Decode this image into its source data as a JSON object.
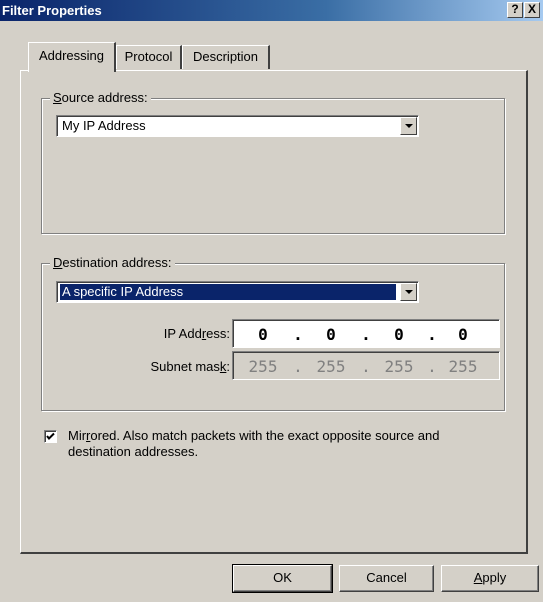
{
  "window": {
    "title": "Filter Properties",
    "help_button": "?",
    "close_button": "X"
  },
  "tabs": [
    {
      "label": "Addressing",
      "active": true
    },
    {
      "label": "Protocol",
      "active": false
    },
    {
      "label": "Description",
      "active": false
    }
  ],
  "source": {
    "legend_mnemonic": "S",
    "legend_rest": "ource address:",
    "selected": "My IP Address"
  },
  "destination": {
    "legend_mnemonic": "D",
    "legend_rest": "estination address:",
    "selected": "A specific IP Address",
    "ip_label_pre": "IP Add",
    "ip_label_mnemonic": "r",
    "ip_label_post": "ess:",
    "ip_octets": [
      "0",
      "0",
      "0",
      "0"
    ],
    "subnet_label_pre": "Subnet mas",
    "subnet_label_mnemonic": "k",
    "subnet_label_post": ":",
    "subnet_octets": [
      "255",
      "255",
      "255",
      "255"
    ],
    "separator": "."
  },
  "mirrored": {
    "checked": true,
    "label_pre": "Mir",
    "label_mnemonic": "r",
    "label_post": "ored. Also match packets with the exact opposite source and",
    "label_line2": "destination addresses."
  },
  "buttons": {
    "ok": "OK",
    "cancel": "Cancel",
    "apply_mnemonic": "A",
    "apply_rest": "pply"
  },
  "colors": {
    "title_start": "#0a246a",
    "title_end": "#a6caf0",
    "face": "#d4d0c8",
    "selection": "#0a246a"
  }
}
